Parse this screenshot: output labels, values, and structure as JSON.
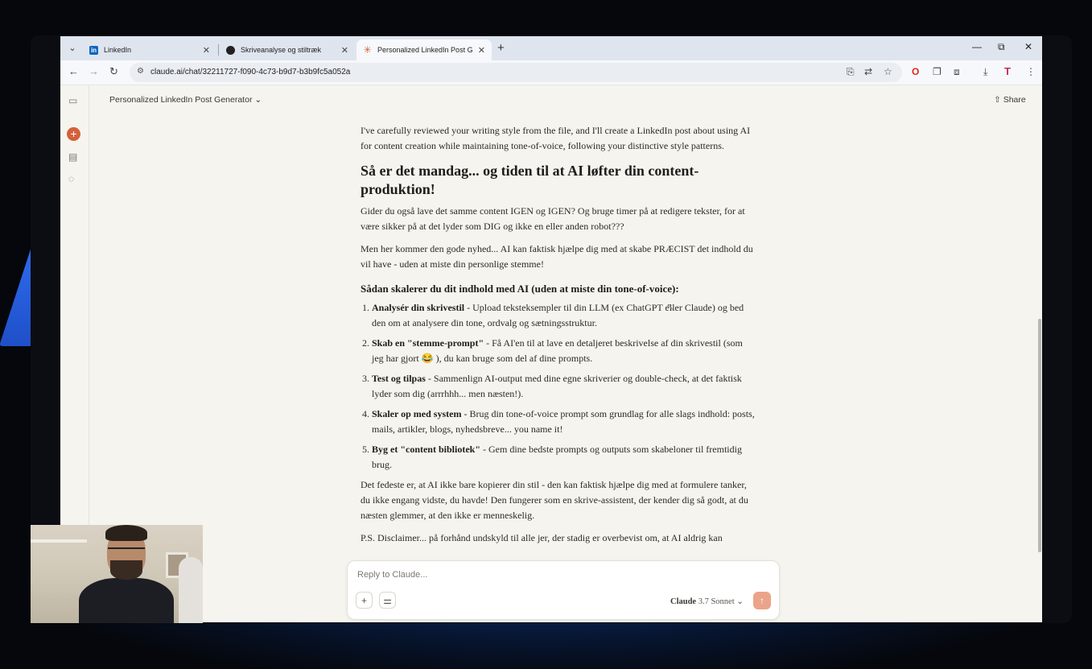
{
  "tabs": [
    {
      "title": "LinkedIn",
      "icon": "linkedin-icon",
      "active": false
    },
    {
      "title": "Skriveanalyse og stiltræk",
      "icon": "chatgpt-icon",
      "active": false
    },
    {
      "title": "Personalized LinkedIn Post Gene",
      "icon": "claude-icon",
      "active": true
    }
  ],
  "toolbar": {
    "url": "claude.ai/chat/32211727-f090-4c73-b9d7-b3b9fc5a052a"
  },
  "header": {
    "title": "Personalized LinkedIn Post Generator",
    "share_label": "Share"
  },
  "message": {
    "intro": "I've carefully reviewed your writing style from the file, and I'll create a LinkedIn post about using AI for content creation while maintaining tone-of-voice, following your distinctive style patterns.",
    "headline": "Så er det mandag... og tiden til at AI løfter din content-produktion!",
    "para1": "Gider du også lave det samme content IGEN og IGEN? Og bruge timer på at redigere tekster, for at være sikker på at det lyder som DIG og ikke en eller anden robot???",
    "para2": "Men her kommer den gode nyhed... AI kan faktisk hjælpe dig med at skabe PRÆCIST det indhold du vil have - uden at miste din personlige stemme!",
    "subheading": "Sådan skalerer du dit indhold med AI (uden at miste din tone-of-voice):",
    "steps": [
      {
        "bold": "Analysér din skrivestil",
        "text": " - Upload teksteksempler til din LLM (ex ChatGPT eller Claude) og bed den om at analysere din tone, ordvalg og sætningsstruktur."
      },
      {
        "bold": "Skab en \"stemme-prompt\"",
        "text": " - Få AI'en til at lave en detaljeret beskrivelse af din skrivestil (som jeg har gjort 😂 ), du kan bruge som del af dine prompts."
      },
      {
        "bold": "Test og tilpas",
        "text": " - Sammenlign AI-output med dine egne skriverier og double-check, at det faktisk lyder som dig (arrrhhh... men næsten!)."
      },
      {
        "bold": "Skaler op med system",
        "text": " - Brug din tone-of-voice prompt som grundlag for alle slags indhold: posts, mails, artikler, blogs, nyhedsbreve... you name it!"
      },
      {
        "bold": "Byg et \"content bibliotek\"",
        "text": " - Gem dine bedste prompts og outputs som skabeloner til fremtidig brug."
      }
    ],
    "para3": "Det fedeste er, at AI ikke bare kopierer din stil - den kan faktisk hjælpe dig med at formulere tanker, du ikke engang vidste, du havde! Den fungerer som en skrive-assistent, der kender dig så godt, at du næsten glemmer, at den ikke er menneskelig.",
    "para4": "P.S. Disclaimer... på forhånd undskyld til alle jer, der stadig er overbevist om, at AI aldrig kan"
  },
  "composer": {
    "placeholder": "Reply to Claude...",
    "model_name": "Claude",
    "model_version": "3.7 Sonnet"
  },
  "colors": {
    "accent": "#d5603a",
    "send": "#eba489",
    "page_bg": "#f5f4ef"
  }
}
